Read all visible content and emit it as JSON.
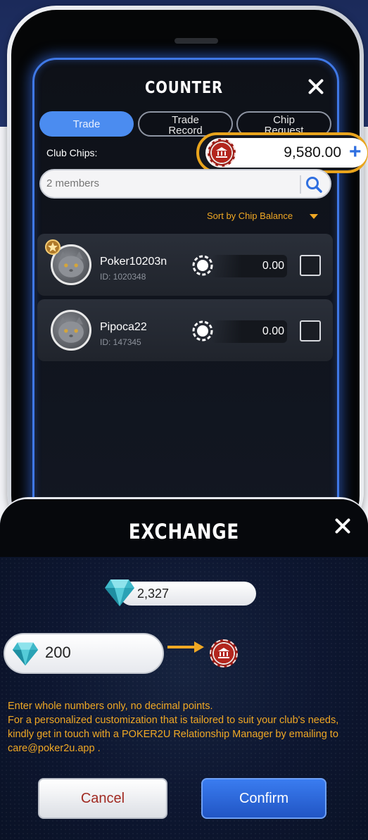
{
  "counter": {
    "title": "COUNTER",
    "tabs": [
      {
        "label": "Trade",
        "active": true
      },
      {
        "label": "Trade Record",
        "active": false
      },
      {
        "label": "Chip Request",
        "active": false
      }
    ],
    "club_chips_label": "Club Chips:",
    "club_chips_value": "9,580.00",
    "search": {
      "placeholder": "2 members"
    },
    "sort_label": "Sort by Chip Balance",
    "members": [
      {
        "name": "Poker10203n",
        "id": "ID: 1020348",
        "chips": "0.00",
        "badge": "star"
      },
      {
        "name": "Pipoca22",
        "id": "ID: 147345",
        "chips": "0.00"
      }
    ]
  },
  "exchange": {
    "title": "EXCHANGE",
    "diamond_balance": "2,327",
    "input_value": "200",
    "notice": [
      "Enter whole numbers only, no decimal points.",
      "For a personalized customization that is tailored to suit your club's needs, kindly get in touch with a POKER2U Relationship Manager by emailing to care@poker2u.app ."
    ],
    "cancel_label": "Cancel",
    "confirm_label": "Confirm"
  },
  "colors": {
    "accent_blue": "#3f78e6",
    "accent_orange": "#f0a824",
    "chip_red": "#b3261e",
    "cancel_text": "#a12a22"
  }
}
